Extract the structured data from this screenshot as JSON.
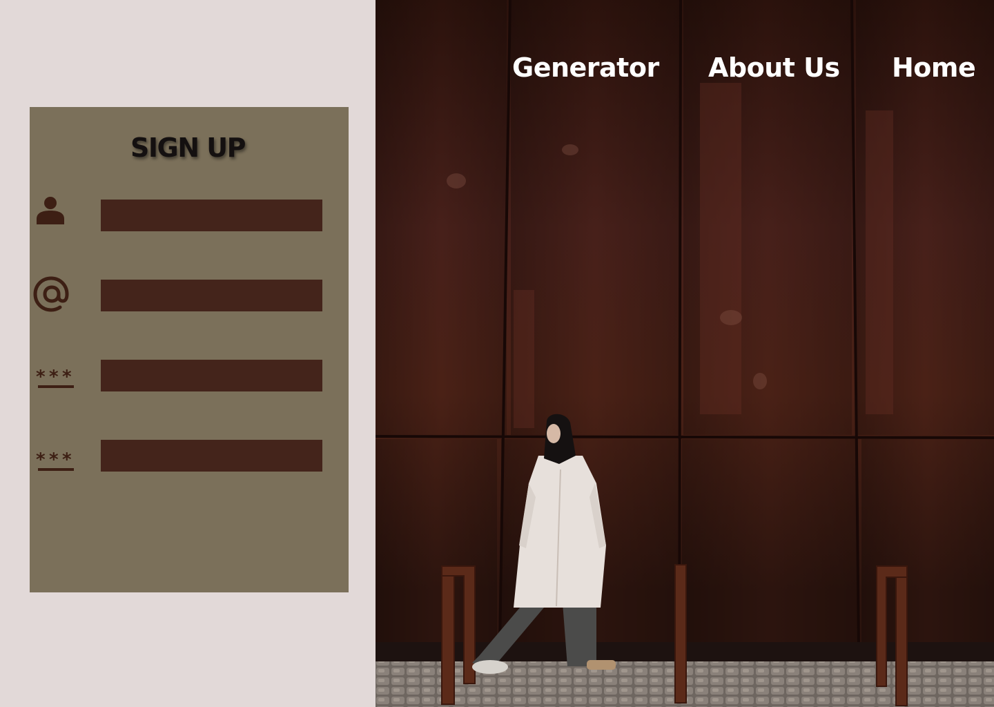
{
  "signup": {
    "title": "SIGN UP",
    "fields": [
      {
        "icon": "user-icon",
        "value": "",
        "placeholder": ""
      },
      {
        "icon": "at-sign-icon",
        "value": "",
        "placeholder": ""
      },
      {
        "icon": "password-icon",
        "value": "",
        "placeholder": ""
      },
      {
        "icon": "password-icon",
        "value": "",
        "placeholder": ""
      }
    ]
  },
  "nav": {
    "items": [
      {
        "label": "Generator"
      },
      {
        "label": "About Us"
      },
      {
        "label": "Home"
      }
    ]
  },
  "hero": {
    "image": "woman-in-white-coat-before-rusted-steel-wall"
  },
  "colors": {
    "page_background": "#e2d9d8",
    "card_background": "#7b705a",
    "input_fill": "#44241b",
    "icon_color": "#3d1f14",
    "title_color": "#141010",
    "nav_text": "#ffffff"
  }
}
